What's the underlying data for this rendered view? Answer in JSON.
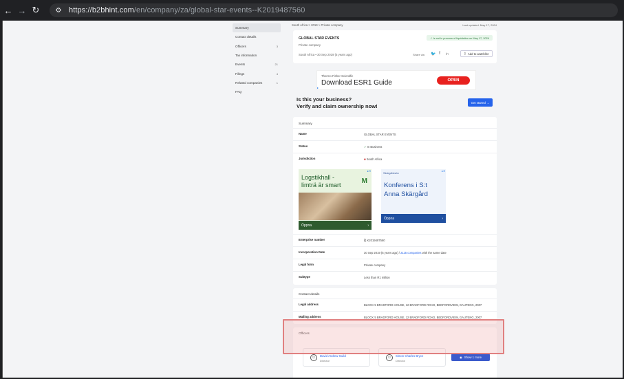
{
  "browser": {
    "url_host": "https://b2bhint.com",
    "url_path": "/en/company/za/global-star-events--K2019487560"
  },
  "sidebar": {
    "items": [
      {
        "label": "Summary",
        "count": ""
      },
      {
        "label": "Contact details",
        "count": ""
      },
      {
        "label": "Officers",
        "count": "3"
      },
      {
        "label": "Tax information",
        "count": ""
      },
      {
        "label": "Events",
        "count": "21"
      },
      {
        "label": "Filings",
        "count": "4"
      },
      {
        "label": "Related companies",
        "count": "1"
      },
      {
        "label": "FAQ",
        "count": ""
      }
    ]
  },
  "breadcrumb": {
    "c1": "South Africa",
    "c2": "2019",
    "c3": "Private company"
  },
  "last_updated": "Last updated: May 17, 2024",
  "header": {
    "name": "GLOBAL STAR EVENTS",
    "type": "Private company",
    "location": "South Africa • 30 Sep 2019 (5 years ago)",
    "liquidation": "Is not in process of liquidation on May 17, 2024",
    "share_label": "Share via",
    "watchlist": "Add to watchlist"
  },
  "ad_top": {
    "small": "Thermo Fisher Scientific",
    "title": "Download ESR1 Guide",
    "button": "OPEN"
  },
  "claim": {
    "line1": "Is this your business?",
    "line2": "Verify and claim ownership now!",
    "button": "Get started →"
  },
  "summary": {
    "title": "Summary",
    "name_label": "Name",
    "name_value": "GLOBAL STAR EVENTS",
    "status_label": "Status",
    "status_value": "In Business",
    "jurisdiction_label": "Jurisdiction",
    "jurisdiction_value": "South Africa",
    "enterprise_label": "Enterprise number",
    "enterprise_value": "K2019487560",
    "incorp_label": "Incorporation Date",
    "incorp_value": "30 Sep 2019 (5 years ago) /",
    "incorp_link": "2115 companies",
    "incorp_suffix": "with the same date",
    "legal_label": "Legal form",
    "legal_value": "Private company",
    "subtype_label": "Subtype",
    "subtype_value": "Less than R1 million"
  },
  "ad_left": {
    "title1": "Logstikhall -",
    "title2": "limträ är smart",
    "logo": "M",
    "cta": "Öppna"
  },
  "ad_right": {
    "small": "Skärgårdsön",
    "title1": "Konferens i S:t",
    "title2": "Anna Skärgård",
    "cta": "Öppna"
  },
  "contact": {
    "title": "Contact details",
    "legal_label": "Legal address",
    "legal_value": "BLOCK 5 BRADFORD HOUSE, 12 BRADFORD ROAD, BEDFORDVIEW, GAUTENG, 2007",
    "mailing_label": "Mailing address",
    "mailing_value": "BLOCK 5 BRADFORD HOUSE, 12 BRADFORD ROAD, BEDFORDVIEW, GAUTENG, 2007"
  },
  "officers": {
    "title": "Officers",
    "list": [
      {
        "name": "David Andrew Guild",
        "role": "Director"
      },
      {
        "name": "Simon Charles Bryce",
        "role": "Director"
      }
    ],
    "show_more": "Show 1 more"
  }
}
